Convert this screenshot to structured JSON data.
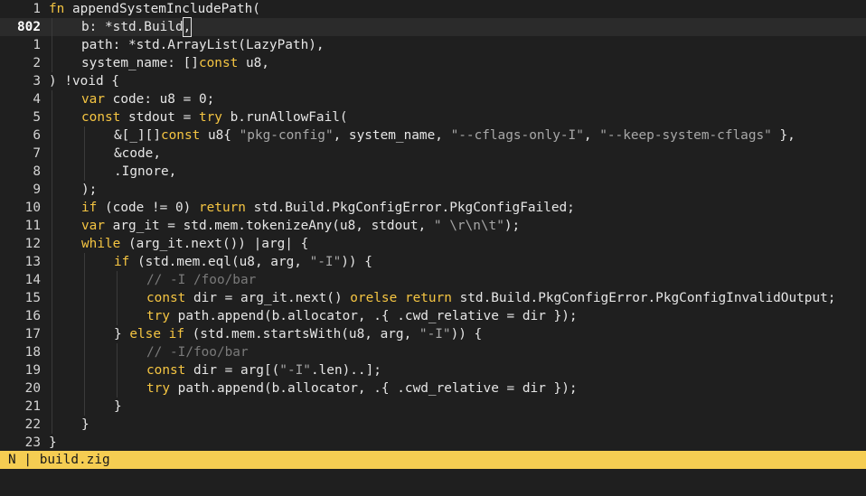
{
  "editor": {
    "current_line_index": 1,
    "lines": [
      {
        "num": "1",
        "indent": 0,
        "segments": [
          [
            "kw",
            "fn"
          ],
          [
            "id",
            " appendSystemIncludePath("
          ]
        ]
      },
      {
        "num": "802",
        "indent": 1,
        "segments": [
          [
            "id",
            "b: *std.Build"
          ],
          [
            "cursor",
            ","
          ]
        ]
      },
      {
        "num": "1",
        "indent": 1,
        "segments": [
          [
            "id",
            "path: *std.ArrayList(LazyPath),"
          ]
        ]
      },
      {
        "num": "2",
        "indent": 1,
        "segments": [
          [
            "id",
            "system_name: []"
          ],
          [
            "kw",
            "const"
          ],
          [
            "id",
            " u8,"
          ]
        ]
      },
      {
        "num": "3",
        "indent": 0,
        "segments": [
          [
            "id",
            ") !void {"
          ]
        ]
      },
      {
        "num": "4",
        "indent": 1,
        "segments": [
          [
            "kw",
            "var"
          ],
          [
            "id",
            " code: u8 = 0;"
          ]
        ]
      },
      {
        "num": "5",
        "indent": 1,
        "segments": [
          [
            "kw",
            "const"
          ],
          [
            "id",
            " stdout = "
          ],
          [
            "kw",
            "try"
          ],
          [
            "id",
            " b.runAllowFail("
          ]
        ]
      },
      {
        "num": "6",
        "indent": 2,
        "segments": [
          [
            "id",
            "&[_][]"
          ],
          [
            "kw",
            "const"
          ],
          [
            "id",
            " u8{ "
          ],
          [
            "str",
            "\"pkg-config\""
          ],
          [
            "id",
            ", system_name, "
          ],
          [
            "str",
            "\"--cflags-only-I\""
          ],
          [
            "id",
            ", "
          ],
          [
            "str",
            "\"--keep-system-cflags\""
          ],
          [
            "id",
            " },"
          ]
        ]
      },
      {
        "num": "7",
        "indent": 2,
        "segments": [
          [
            "id",
            "&code,"
          ]
        ]
      },
      {
        "num": "8",
        "indent": 2,
        "segments": [
          [
            "id",
            ".Ignore,"
          ]
        ]
      },
      {
        "num": "9",
        "indent": 1,
        "segments": [
          [
            "id",
            ");"
          ]
        ]
      },
      {
        "num": "10",
        "indent": 1,
        "segments": [
          [
            "kw",
            "if"
          ],
          [
            "id",
            " (code != 0) "
          ],
          [
            "kw",
            "return"
          ],
          [
            "id",
            " std.Build.PkgConfigError.PkgConfigFailed;"
          ]
        ]
      },
      {
        "num": "11",
        "indent": 1,
        "segments": [
          [
            "kw",
            "var"
          ],
          [
            "id",
            " arg_it = std.mem.tokenizeAny(u8, stdout, "
          ],
          [
            "str",
            "\" \\r\\n\\t\""
          ],
          [
            "id",
            ");"
          ]
        ]
      },
      {
        "num": "12",
        "indent": 1,
        "segments": [
          [
            "kw",
            "while"
          ],
          [
            "id",
            " (arg_it.next()) |arg| {"
          ]
        ]
      },
      {
        "num": "13",
        "indent": 2,
        "segments": [
          [
            "kw",
            "if"
          ],
          [
            "id",
            " (std.mem.eql(u8, arg, "
          ],
          [
            "str",
            "\"-I\""
          ],
          [
            "id",
            ")) {"
          ]
        ]
      },
      {
        "num": "14",
        "indent": 3,
        "segments": [
          [
            "cm",
            "// -I /foo/bar"
          ]
        ]
      },
      {
        "num": "15",
        "indent": 3,
        "segments": [
          [
            "kw",
            "const"
          ],
          [
            "id",
            " dir = arg_it.next() "
          ],
          [
            "kw",
            "orelse"
          ],
          [
            "id",
            " "
          ],
          [
            "kw",
            "return"
          ],
          [
            "id",
            " std.Build.PkgConfigError.PkgConfigInvalidOutput;"
          ]
        ]
      },
      {
        "num": "16",
        "indent": 3,
        "segments": [
          [
            "kw",
            "try"
          ],
          [
            "id",
            " path.append(b.allocator, .{ .cwd_relative = dir });"
          ]
        ]
      },
      {
        "num": "17",
        "indent": 2,
        "segments": [
          [
            "id",
            "} "
          ],
          [
            "kw",
            "else"
          ],
          [
            "id",
            " "
          ],
          [
            "kw",
            "if"
          ],
          [
            "id",
            " (std.mem.startsWith(u8, arg, "
          ],
          [
            "str",
            "\"-I\""
          ],
          [
            "id",
            ")) {"
          ]
        ]
      },
      {
        "num": "18",
        "indent": 3,
        "segments": [
          [
            "cm",
            "// -I/foo/bar"
          ]
        ]
      },
      {
        "num": "19",
        "indent": 3,
        "segments": [
          [
            "kw",
            "const"
          ],
          [
            "id",
            " dir = arg[("
          ],
          [
            "str",
            "\"-I\""
          ],
          [
            "id",
            ".len)..];"
          ]
        ]
      },
      {
        "num": "20",
        "indent": 3,
        "segments": [
          [
            "kw",
            "try"
          ],
          [
            "id",
            " path.append(b.allocator, .{ .cwd_relative = dir });"
          ]
        ]
      },
      {
        "num": "21",
        "indent": 2,
        "segments": [
          [
            "id",
            "}"
          ]
        ]
      },
      {
        "num": "22",
        "indent": 1,
        "segments": [
          [
            "id",
            "}"
          ]
        ]
      },
      {
        "num": "23",
        "indent": 0,
        "segments": [
          [
            "id",
            "}"
          ]
        ]
      }
    ]
  },
  "statusbar": {
    "mode": "N",
    "separator": "|",
    "filename": "build.zig"
  },
  "colors": {
    "keyword": "#f5c542",
    "statusbar_bg": "#f5cd52",
    "background": "#1f1f1f"
  }
}
